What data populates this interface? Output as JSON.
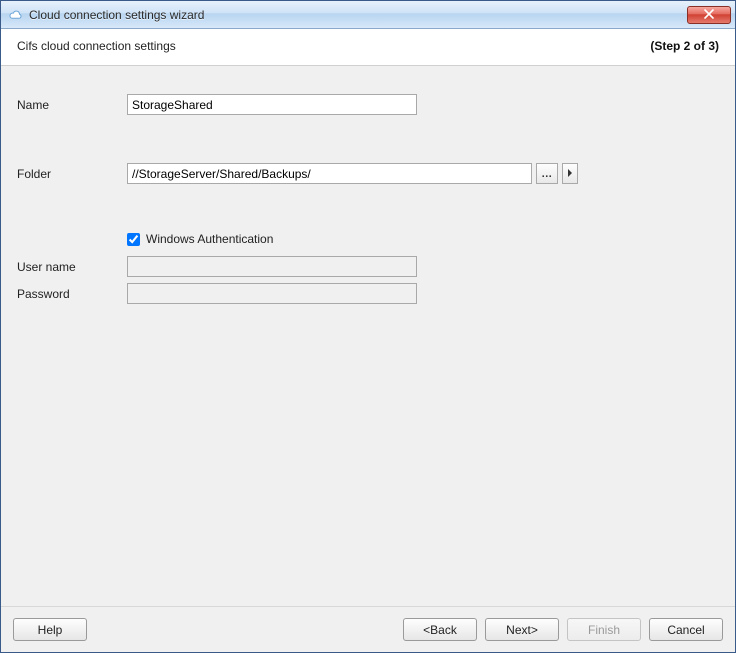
{
  "window": {
    "title": "Cloud connection settings wizard"
  },
  "header": {
    "subtitle": "Cifs cloud connection settings",
    "step": "(Step 2 of 3)"
  },
  "form": {
    "name_label": "Name",
    "name_value": "StorageShared",
    "folder_label": "Folder",
    "folder_value": "//StorageServer/Shared/Backups/",
    "ellipsis_label": "…",
    "winauth_label": "Windows Authentication",
    "winauth_checked": true,
    "username_label": "User name",
    "username_value": "",
    "password_label": "Password",
    "password_value": ""
  },
  "footer": {
    "help": "Help",
    "back": "<Back",
    "next": "Next>",
    "finish": "Finish",
    "cancel": "Cancel"
  }
}
